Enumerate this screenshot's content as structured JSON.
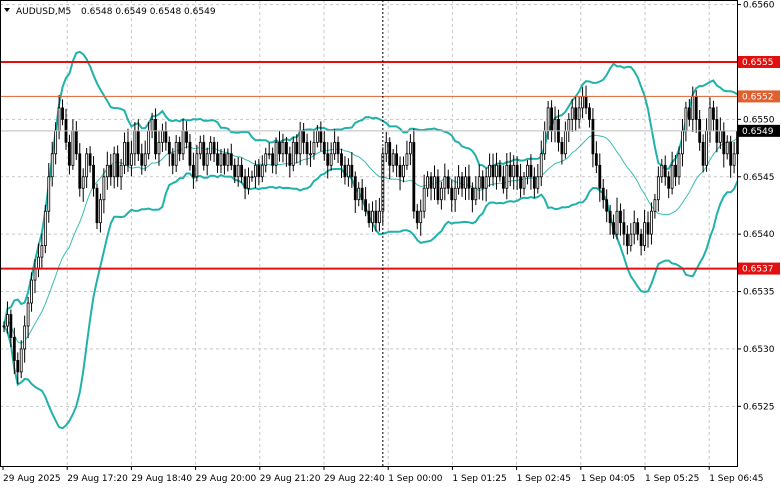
{
  "header": {
    "dropdown_icon": "triangle-down-icon",
    "symbol": "AUDUSD,M5",
    "ohlc": "0.6548 0.6549 0.6548 0.6549"
  },
  "price_axis": {
    "ticks": [
      "0.6560",
      "0.6550",
      "0.6545",
      "0.6540",
      "0.6535",
      "0.6530",
      "0.6525"
    ]
  },
  "time_axis": {
    "ticks": [
      "29 Aug 2025",
      "29 Aug 17:20",
      "29 Aug 18:40",
      "29 Aug 20:00",
      "29 Aug 21:20",
      "29 Aug 22:40",
      "1 Sep 00:00",
      "1 Sep 01:25",
      "1 Sep 02:45",
      "1 Sep 04:05",
      "1 Sep 05:25",
      "1 Sep 06:45"
    ]
  },
  "levels": [
    {
      "label": "0.6555",
      "value": 0.6555,
      "color": "#e01010"
    },
    {
      "label": "0.6552",
      "value": 0.6552,
      "color": "#e06030"
    },
    {
      "label": "0.6537",
      "value": 0.6537,
      "color": "#e01010"
    }
  ],
  "current_price": {
    "label": "0.6549",
    "value": 0.6549
  },
  "colors": {
    "band": "#20b2aa",
    "mid": "#3cbcb0",
    "candle": "#000000",
    "grid": "#c8c8c8",
    "separator": "#000000"
  },
  "chart_data": {
    "type": "candlestick",
    "ylim": [
      0.65198,
      0.65604
    ],
    "grid": true,
    "period_separator_index": 110,
    "candles_close": [
      0.6532,
      0.6533,
      0.6531,
      0.6529,
      0.6528,
      0.653,
      0.6532,
      0.6534,
      0.6536,
      0.6537,
      0.6538,
      0.6539,
      0.6542,
      0.6545,
      0.6547,
      0.6549,
      0.6551,
      0.655,
      0.6548,
      0.6546,
      0.6549,
      0.6547,
      0.6544,
      0.6545,
      0.6547,
      0.6546,
      0.6544,
      0.6541,
      0.6543,
      0.6545,
      0.6546,
      0.6545,
      0.6547,
      0.6545,
      0.6546,
      0.6548,
      0.6546,
      0.6547,
      0.6549,
      0.6547,
      0.6546,
      0.6547,
      0.6549,
      0.655,
      0.6547,
      0.6548,
      0.6549,
      0.6548,
      0.6547,
      0.6546,
      0.6548,
      0.6547,
      0.6549,
      0.6548,
      0.6546,
      0.6545,
      0.6547,
      0.6548,
      0.6546,
      0.6547,
      0.6548,
      0.6547,
      0.6546,
      0.6547,
      0.6546,
      0.6547,
      0.6546,
      0.6545,
      0.6546,
      0.6545,
      0.6544,
      0.6545,
      0.6545,
      0.6546,
      0.6545,
      0.6546,
      0.6547,
      0.6547,
      0.6546,
      0.6548,
      0.6547,
      0.6548,
      0.6547,
      0.6546,
      0.6548,
      0.6547,
      0.6549,
      0.6548,
      0.6547,
      0.6547,
      0.6548,
      0.6549,
      0.6548,
      0.6547,
      0.6546,
      0.6547,
      0.6548,
      0.6547,
      0.6546,
      0.6545,
      0.6546,
      0.6545,
      0.6543,
      0.6544,
      0.6543,
      0.6542,
      0.6541,
      0.6542,
      0.6541,
      0.6542,
      0.6547,
      0.6548,
      0.6546,
      0.6547,
      0.6546,
      0.6545,
      0.6546,
      0.6547,
      0.6548,
      0.6542,
      0.6541,
      0.6542,
      0.6544,
      0.6545,
      0.6544,
      0.6545,
      0.6543,
      0.6544,
      0.6545,
      0.6544,
      0.6543,
      0.6544,
      0.6545,
      0.6544,
      0.6545,
      0.6544,
      0.6543,
      0.6544,
      0.6545,
      0.6544,
      0.6545,
      0.6546,
      0.6545,
      0.6546,
      0.6545,
      0.6544,
      0.6546,
      0.6545,
      0.6546,
      0.6545,
      0.6544,
      0.6545,
      0.6546,
      0.6545,
      0.6544,
      0.6545,
      0.6547,
      0.6549,
      0.6551,
      0.6549,
      0.655,
      0.6548,
      0.6547,
      0.6549,
      0.655,
      0.6551,
      0.655,
      0.6551,
      0.6552,
      0.6551,
      0.655,
      0.6547,
      0.6546,
      0.6544,
      0.6543,
      0.6542,
      0.6541,
      0.654,
      0.6542,
      0.6541,
      0.654,
      0.6539,
      0.654,
      0.6541,
      0.654,
      0.6539,
      0.6541,
      0.654,
      0.6542,
      0.6543,
      0.6545,
      0.6546,
      0.6545,
      0.6544,
      0.6546,
      0.6545,
      0.6547,
      0.6549,
      0.6551,
      0.655,
      0.6552,
      0.655,
      0.6548,
      0.6546,
      0.6549,
      0.6551,
      0.655,
      0.6548,
      0.6549,
      0.6547,
      0.6548,
      0.6546,
      0.6547,
      0.6549
    ]
  }
}
